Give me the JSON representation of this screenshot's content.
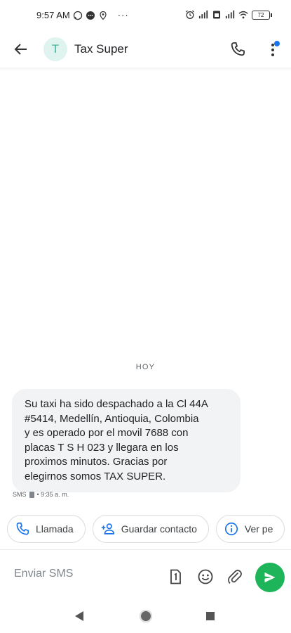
{
  "status_bar": {
    "time": "9:57 AM",
    "battery": "72"
  },
  "header": {
    "avatar_letter": "T",
    "contact_name": "Tax Super"
  },
  "conversation": {
    "date_separator": "HOY",
    "message": {
      "text": "Su taxi ha sido despachado a la Cl 44A\n#5414, Medellín, Antioquia, Colombia\ny es operado por el movil 7688  con\nplacas T  S  H  023  y llegara en los\nproximos minutos. Gracias por\nelegirnos somos TAX SUPER.",
      "channel": "SMS",
      "time": "• 9:35 a. m."
    }
  },
  "suggestions": [
    {
      "label": "Llamada",
      "icon": "phone-icon"
    },
    {
      "label": "Guardar contacto",
      "icon": "add-person-icon"
    },
    {
      "label": "Ver pe",
      "icon": "info-icon"
    }
  ],
  "composer": {
    "placeholder": "Enviar SMS"
  },
  "colors": {
    "accent_blue": "#1a73e8",
    "send_green": "#1eb45a",
    "bubble_bg": "#f1f3f4"
  }
}
